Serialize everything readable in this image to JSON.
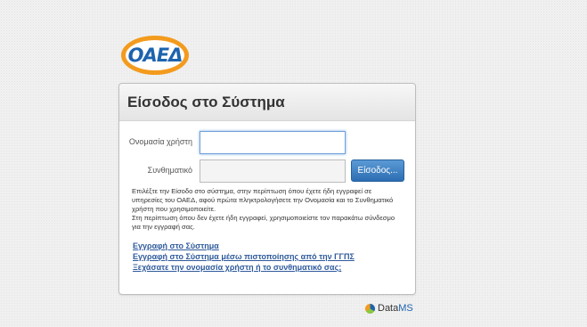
{
  "logo": {
    "text": "ΟΑΕΔ"
  },
  "panel": {
    "title": "Είσοδος στο Σύστημα"
  },
  "form": {
    "username_label": "Ονομασία χρήστη",
    "username_value": "",
    "password_label": "Συνθηματικό",
    "password_value": "",
    "login_button": "Είσοδος..."
  },
  "help": {
    "paragraph1": "Επιλέξτε την Είσοδο στο σύστημα, στην περίπτωση όπου έχετε ήδη εγγραφεί σε υπηρεσίες του ΟΑΕΔ, αφού πρώτα πληκτρολογήσετε την Ονομασία και το Συνθηματικό χρήστη που χρησιμοποιείτε.",
    "paragraph2": "Στη περίπτωση όπου δεν έχετε ήδη εγγραφεί, χρησιμοποιείστε τον παρακάτω σύνδεσμο για την εγγραφή σας."
  },
  "links": {
    "register": "Εγγραφή στο Σύστημα",
    "register_ggps": "Εγγραφή στο Σύστημα μέσω πιστοποίησης από την ΓΓΠΣ",
    "forgot": "Ξεχάσατε την ονομασία χρήστη ή το συνθηματικό σας;"
  },
  "footer": {
    "brand_main": "Data",
    "brand_accent": "MS"
  },
  "colors": {
    "accent_blue": "#1d63ae",
    "logo_orange": "#f39b1e",
    "link": "#2e5a9c"
  }
}
